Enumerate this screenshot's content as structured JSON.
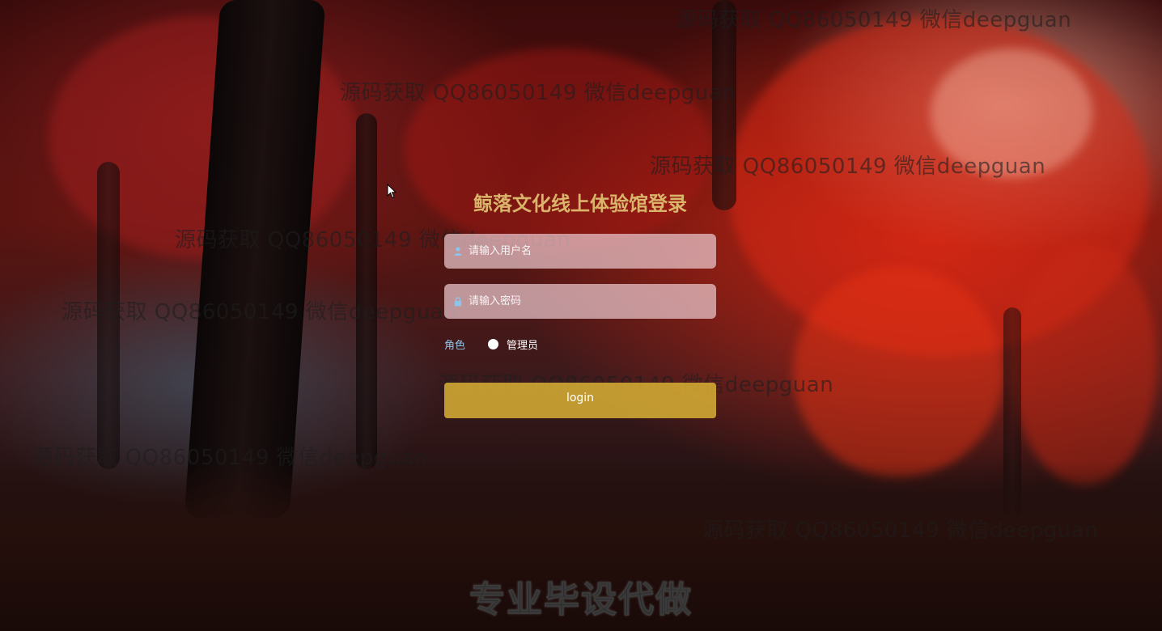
{
  "login": {
    "title": "鲸落文化线上体验馆登录",
    "username_placeholder": "请输入用户名",
    "password_placeholder": "请输入密码",
    "role_label": "角色",
    "role_option": "管理员",
    "submit_label": "login"
  },
  "watermarks": [
    "源码获取 QQ86050149 微信deepguan",
    "源码获取 QQ86050149 微信deepguan",
    "源码获取 QQ86050149 微信deepguan",
    "源码获取 QQ86050149 微信deepguan",
    "源码获取 QQ86050149 微信deepguan",
    "源码获取 QQ86050149 微信deepguan",
    "源码获取 QQ86050149 微信deepguan",
    "源码获取 QQ86050149 微信deepguan"
  ],
  "footer": {
    "text": "专业毕设代做"
  },
  "colors": {
    "title": "#d9b46a",
    "button": "#d4ac34",
    "role_label": "#8fc4e8"
  },
  "icons": {
    "username": "user-icon",
    "password": "lock-icon"
  }
}
